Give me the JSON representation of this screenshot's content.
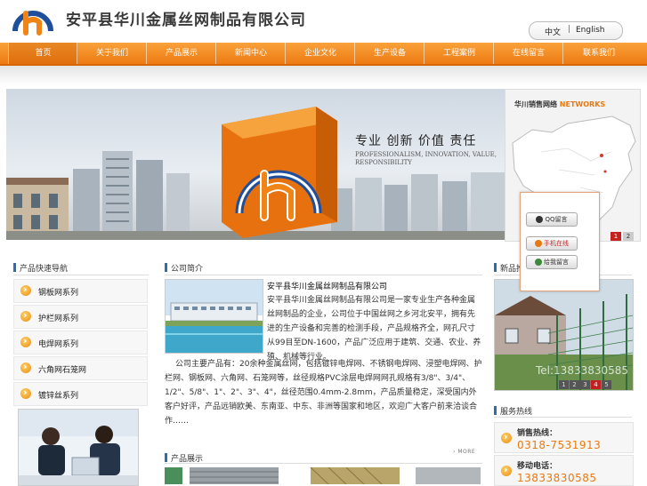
{
  "header": {
    "company_name": "安平县华川金属丝网制品有限公司",
    "lang_cn": "中文",
    "lang_en": "English"
  },
  "nav": {
    "items": [
      "首页",
      "关于我们",
      "产品展示",
      "新闻中心",
      "企业文化",
      "生产设备",
      "工程案例",
      "在线留言",
      "联系我们"
    ],
    "active_index": 0
  },
  "banner": {
    "slogan_cn": "专业  创新  价值  责任",
    "slogan_en": "PROFESSIONALISM, INNOVATION, VALUE, RESPONSIBILITY"
  },
  "network": {
    "title_cn": "华川销售网络",
    "title_en": "NETWORKS",
    "pager": [
      "1",
      "2"
    ],
    "active_page": "1"
  },
  "qq_panel": {
    "qq_label": "QQ留言",
    "mobile_label": "手机在线",
    "message_label": "给我留言"
  },
  "left": {
    "quicknav_title": "产品快速导航",
    "quicknav_items": [
      "钢板网系列",
      "护栏网系列",
      "电焊网系列",
      "六角网石笼网",
      "镀锌丝系列"
    ]
  },
  "about": {
    "title": "公司简介",
    "heading": "安平县华川金属丝网制品有限公司",
    "para1": "安平县华川金属丝网制品有限公司是一家专业生产各种金属丝网制品的企业，公司位于中国丝网之乡河北安平，拥有先进的生产设备和完善的检测手段，产品规格齐全，网孔尺寸从99目至DN-1600，产品广泛应用于建筑、交通、农业、养殖、机械等行业。",
    "para2": "公司主要产品有：20余种金属丝网，包括镀锌电焊网、不锈钢电焊网、浸塑电焊网、护栏网、钢板网、六角网、石笼网等，丝径规格PVC涂层电焊网网孔规格有3/8\"、3/4\"、1/2\"、5/8\"、1\"、2\"、3\"、4\"，丝径范围0.4mm-2.8mm，产品质量稳定，深受国内外客户好评，产品远销欧美、东南亚、中东、非洲等国家和地区，欢迎广大客户前来洽谈合作……",
    "more": "MORE"
  },
  "products": {
    "title": "产品展示"
  },
  "right": {
    "newprod_title": "新品推荐",
    "watermark": "Tel:13833830585",
    "pager": [
      "1",
      "2",
      "3",
      "4",
      "5"
    ],
    "active_page": "4",
    "hotline_title": "服务热线",
    "sales_label": "销售热线：",
    "sales_number": "0318-7531913",
    "mobile_label": "移动电话：",
    "mobile_number": "13833830585"
  },
  "colors": {
    "nav_orange": "#f08416",
    "accent_orange": "#e9790e",
    "title_blue": "#2a6db5"
  }
}
